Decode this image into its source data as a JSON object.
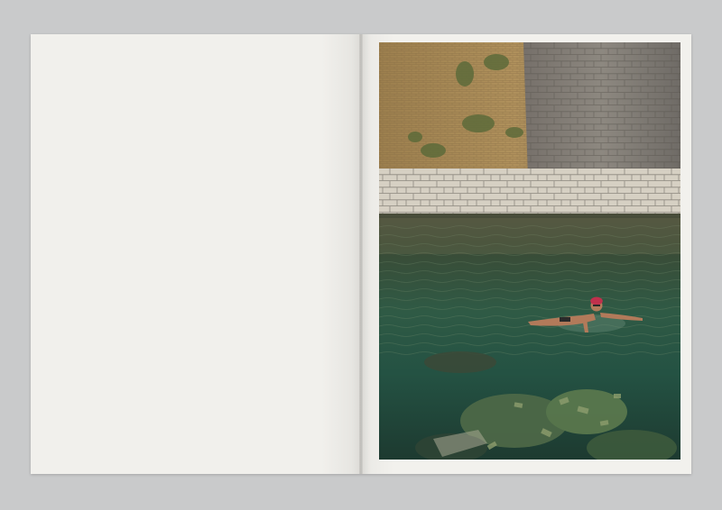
{
  "book": {
    "left_page": {
      "content": ""
    },
    "right_page": {
      "photo": {
        "icon": "photograph-swimmer-icon",
        "colors": {
          "brick": "#a88a58",
          "stone": "#c9c4b8",
          "water_top": "#3c4a33",
          "water_mid": "#2c5a44",
          "water_deep": "#19463a",
          "cap": "#c0304c"
        }
      }
    }
  }
}
